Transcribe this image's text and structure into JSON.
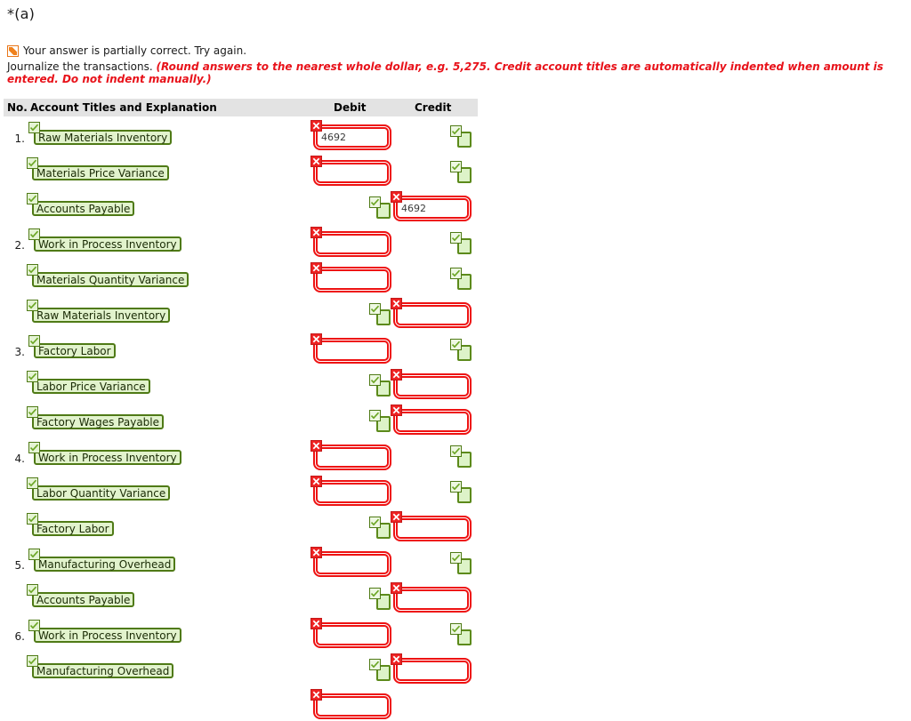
{
  "part_label": "*(a)",
  "feedback": {
    "icon": "partial-correct-icon",
    "text": "Your answer is partially correct.  Try again."
  },
  "instruction": {
    "lead": "Journalize the transactions. ",
    "emphasis": "(Round answers to the nearest whole dollar, e.g. 5,275. Credit account titles are automatically indented when amount is entered. Do not indent manually.)"
  },
  "table": {
    "headers": {
      "no": "No.",
      "account": "Account Titles and Explanation",
      "debit": "Debit",
      "credit": "Credit"
    },
    "rows": [
      {
        "no": "1.",
        "indent": 0,
        "account": "Raw Materials Inventory",
        "debit_value": "4692",
        "debit_state": "error",
        "credit_state": "blank-ok"
      },
      {
        "no": "",
        "indent": 1,
        "account": "Materials Price Variance",
        "debit_value": "",
        "debit_state": "error",
        "credit_state": "blank-ok"
      },
      {
        "no": "",
        "indent": 1,
        "account": "Accounts Payable",
        "credit_value": "4692",
        "debit_state": "blank-ok",
        "credit_state": "error"
      },
      {
        "no": "2.",
        "indent": 0,
        "account": "Work in Process Inventory",
        "debit_value": "",
        "debit_state": "error",
        "credit_state": "blank-ok"
      },
      {
        "no": "",
        "indent": 1,
        "account": "Materials Quantity Variance",
        "debit_value": "",
        "debit_state": "error",
        "credit_state": "blank-ok"
      },
      {
        "no": "",
        "indent": 1,
        "account": "Raw Materials Inventory",
        "credit_value": "",
        "debit_state": "blank-ok",
        "credit_state": "error"
      },
      {
        "no": "3.",
        "indent": 0,
        "account": "Factory Labor",
        "debit_value": "",
        "debit_state": "error",
        "credit_state": "blank-ok"
      },
      {
        "no": "",
        "indent": 1,
        "account": "Labor Price Variance",
        "credit_value": "",
        "debit_state": "blank-ok",
        "credit_state": "error"
      },
      {
        "no": "",
        "indent": 1,
        "account": "Factory Wages Payable",
        "credit_value": "",
        "debit_state": "blank-ok",
        "credit_state": "error"
      },
      {
        "no": "4.",
        "indent": 0,
        "account": "Work in Process Inventory",
        "debit_value": "",
        "debit_state": "error",
        "credit_state": "blank-ok"
      },
      {
        "no": "",
        "indent": 1,
        "account": "Labor Quantity Variance",
        "debit_value": "",
        "debit_state": "error",
        "credit_state": "blank-ok"
      },
      {
        "no": "",
        "indent": 1,
        "account": "Factory Labor",
        "credit_value": "",
        "debit_state": "blank-ok",
        "credit_state": "error"
      },
      {
        "no": "5.",
        "indent": 0,
        "account": "Manufacturing Overhead",
        "debit_value": "",
        "debit_state": "error",
        "credit_state": "blank-ok"
      },
      {
        "no": "",
        "indent": 1,
        "account": "Accounts Payable",
        "credit_value": "",
        "debit_state": "blank-ok",
        "credit_state": "error"
      },
      {
        "no": "6.",
        "indent": 0,
        "account": "Work in Process Inventory",
        "debit_value": "",
        "debit_state": "error",
        "credit_state": "blank-ok"
      },
      {
        "no": "",
        "indent": 1,
        "account": "Manufacturing Overhead",
        "credit_value": "",
        "debit_state": "blank-ok",
        "credit_state": "error"
      },
      {
        "no": "",
        "indent": 1,
        "account": "",
        "debit_value": "",
        "debit_state": "error",
        "credit_state": "none"
      }
    ]
  },
  "colors": {
    "error_red": "#ee1111",
    "ok_green": "#4f7a16",
    "partial_orange": "#e8761a",
    "instruction_red": "#e8121a",
    "header_gray": "#e3e3e3"
  }
}
